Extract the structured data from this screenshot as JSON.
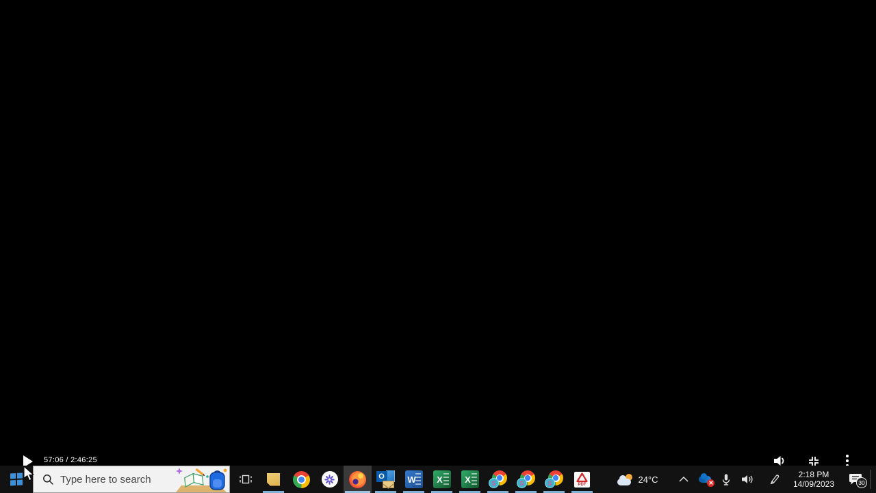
{
  "video_player": {
    "time_display": "57:06 / 2:46:25",
    "icons": [
      "play-icon",
      "volume-icon",
      "exit-fullscreen-icon",
      "more-options-icon"
    ]
  },
  "taskbar": {
    "colors": {
      "background": "#121212",
      "accent_underline": "#7fb0d6",
      "start_blue": "#3a91dc"
    },
    "search": {
      "placeholder": "Type here to search"
    },
    "apps": [
      {
        "id": "task-view",
        "running": false,
        "active": false
      },
      {
        "id": "sticky-notes",
        "running": true,
        "active": false
      },
      {
        "id": "chrome",
        "running": false,
        "active": false
      },
      {
        "id": "starburst-app",
        "running": false,
        "active": false
      },
      {
        "id": "firefox",
        "running": true,
        "active": true
      },
      {
        "id": "outlook",
        "running": true,
        "active": false
      },
      {
        "id": "word",
        "running": true,
        "active": false
      },
      {
        "id": "excel-1",
        "running": true,
        "active": false
      },
      {
        "id": "excel-2",
        "running": true,
        "active": false
      },
      {
        "id": "chrome-profile-1",
        "running": true,
        "active": false
      },
      {
        "id": "chrome-profile-2",
        "running": true,
        "active": false
      },
      {
        "id": "chrome-profile-3",
        "running": true,
        "active": false
      },
      {
        "id": "acrobat",
        "running": true,
        "active": false
      }
    ],
    "glyphs": {
      "outlook_letter": "O",
      "word_letter": "W",
      "excel_letter": "X",
      "chrome_profile_badge": "S",
      "acrobat_label": "PDF"
    },
    "tray": {
      "weather_temp": "24°C",
      "clock_time": "2:18 PM",
      "clock_date": "14/09/2023",
      "notification_count": "30",
      "icons": [
        "weather-icon",
        "chevron-up-icon",
        "onedrive-error-icon",
        "microphone-icon",
        "speaker-icon",
        "pen-icon",
        "action-center-icon",
        "show-desktop-strip"
      ]
    }
  }
}
